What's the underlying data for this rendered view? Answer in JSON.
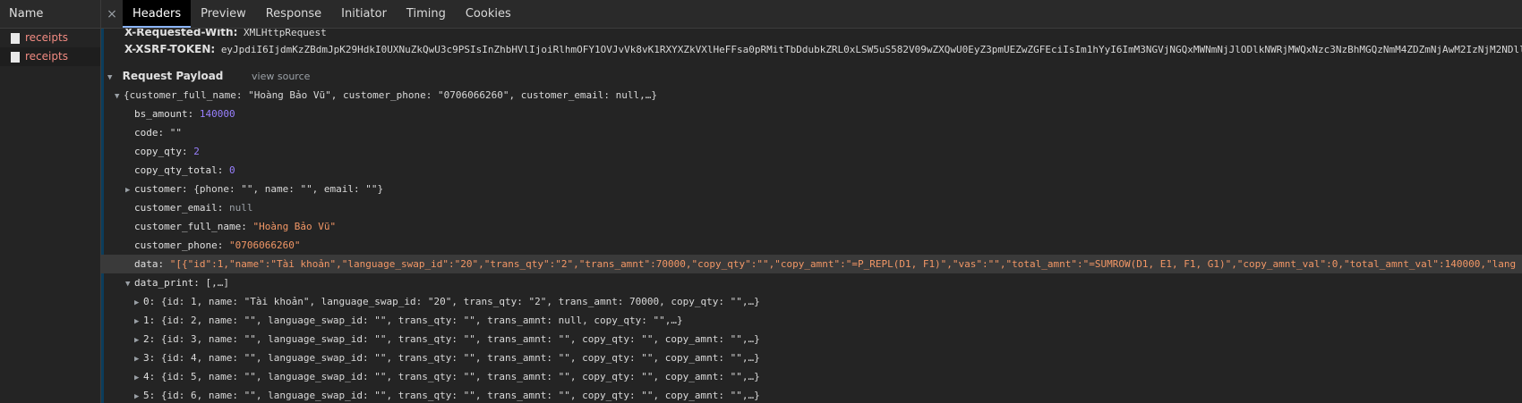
{
  "sidebar": {
    "header": "Name",
    "items": [
      "receipts",
      "receipts"
    ]
  },
  "tabs": {
    "close": "×",
    "items": [
      "Headers",
      "Preview",
      "Response",
      "Initiator",
      "Timing",
      "Cookies"
    ]
  },
  "headers": {
    "xrw_key": "X-Requested-With:",
    "xrw_val": "XMLHttpRequest",
    "xsrf_key": "X-XSRF-TOKEN:",
    "xsrf_val": "eyJpdiI6IjdmKzZBdmJpK29HdkI0UXNuZkQwU3c9PSIsInZhbHVlIjoiRlhmOFY1OVJvVk8vK1RXYXZkVXlHeFFsa0pRMitTbDdubkZRL0xLSW5uS582V09wZXQwU0EyZ3pmUEZwZGFEciIsIm1hYyI6ImM3NGVjNGQxMWNmNjJlODlkNWRjMWQxNzc3NzBhMGQzNmM4ZDZmNjAwM2IzNjM2NDll"
  },
  "payload": {
    "section_title": "Request Payload",
    "view_source": "view source",
    "summary": "{customer_full_name: \"Hoàng Bảo Vũ\", customer_phone: \"0706066260\", customer_email: null,…}",
    "bs_amount_key": "bs_amount: ",
    "bs_amount_val": "140000",
    "code_key": "code: ",
    "code_val": "\"\"",
    "copy_qty_key": "copy_qty: ",
    "copy_qty_val": "2",
    "copy_qty_total_key": "copy_qty_total: ",
    "copy_qty_total_val": "0",
    "customer_key": "customer: ",
    "customer_val": "{phone: \"\", name: \"\", email: \"\"}",
    "customer_email_key": "customer_email: ",
    "customer_email_val": "null",
    "customer_full_name_key": "customer_full_name: ",
    "customer_full_name_val": "\"Hoàng Bảo Vũ\"",
    "customer_phone_key": "customer_phone: ",
    "customer_phone_val": "\"0706066260\"",
    "data_key": "data: ",
    "data_val": "\"[{\"id\":1,\"name\":\"Tài khoản\",\"language_swap_id\":\"20\",\"trans_qty\":\"2\",\"trans_amnt\":70000,\"copy_qty\":\"\",\"copy_amnt\":\"=P_REPL(D1, F1)\",\"vas\":\"\",\"total_amnt\":\"=SUMROW(D1, E1, F1, G1)\",\"copy_amnt_val\":0,\"total_amnt_val\":140000,\"lang",
    "data_print_key": "data_print: ",
    "data_print_val": "[,…]",
    "rows": [
      {
        "idx": "0: ",
        "text": "{id: 1, name: \"Tài khoản\", language_swap_id: \"20\", trans_qty: \"2\", trans_amnt: 70000, copy_qty: \"\",…}"
      },
      {
        "idx": "1: ",
        "text": "{id: 2, name: \"\", language_swap_id: \"\", trans_qty: \"\", trans_amnt: null, copy_qty: \"\",…}"
      },
      {
        "idx": "2: ",
        "text": "{id: 3, name: \"\", language_swap_id: \"\", trans_qty: \"\", trans_amnt: \"\", copy_qty: \"\", copy_amnt: \"\",…}"
      },
      {
        "idx": "3: ",
        "text": "{id: 4, name: \"\", language_swap_id: \"\", trans_qty: \"\", trans_amnt: \"\", copy_qty: \"\", copy_amnt: \"\",…}"
      },
      {
        "idx": "4: ",
        "text": "{id: 5, name: \"\", language_swap_id: \"\", trans_qty: \"\", trans_amnt: \"\", copy_qty: \"\", copy_amnt: \"\",…}"
      },
      {
        "idx": "5: ",
        "text": "{id: 6, name: \"\", language_swap_id: \"\", trans_qty: \"\", trans_amnt: \"\", copy_qty: \"\", copy_amnt: \"\",…}"
      }
    ]
  }
}
